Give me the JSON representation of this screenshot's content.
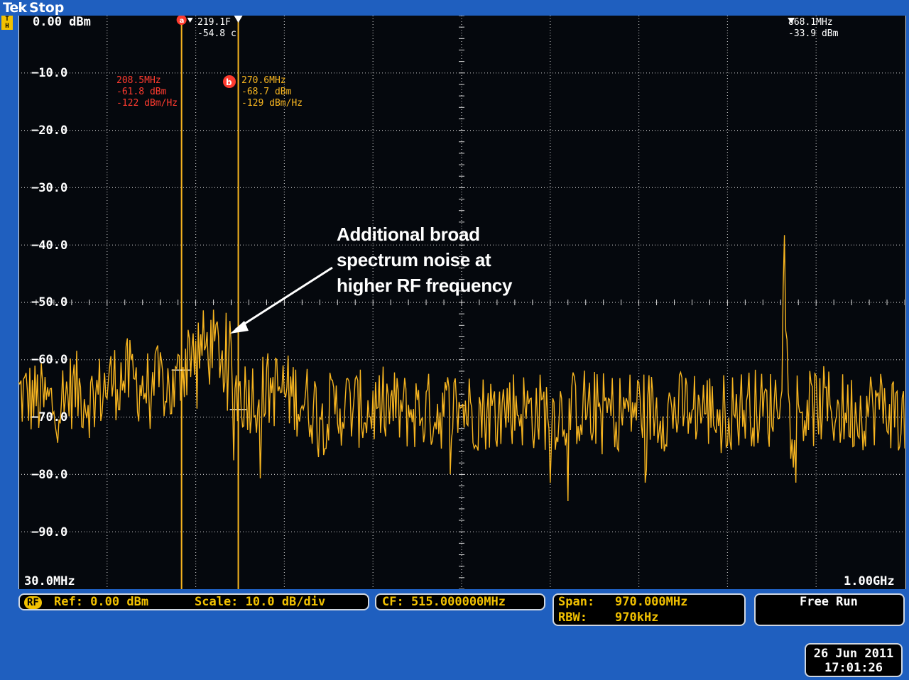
{
  "header": {
    "brand": "Tek",
    "state": "Stop",
    "trigger_badge": "T\nH"
  },
  "y_axis": {
    "top_label": "0.00 dBm",
    "ticks": [
      "−10.0",
      "−20.0",
      "−30.0",
      "−40.0",
      "−50.0",
      "−60.0",
      "−70.0",
      "−80.0",
      "−90.0"
    ]
  },
  "x_axis": {
    "start": "30.0MHz",
    "stop": "1.00GHz"
  },
  "markers": {
    "a": {
      "id": "a",
      "freq": "208.5MHz",
      "level": "-61.8 dBm",
      "density": "-122 dBm/Hz",
      "color": "#ff3b2f"
    },
    "b": {
      "id": "b",
      "freq": "270.6MHz",
      "level": "-68.7 dBm",
      "density": "-129 dBm/Hz",
      "color": "#f7b520"
    },
    "peak1": {
      "freq": "219.1F",
      "level": "-54.8 c"
    },
    "peak2": {
      "freq": "868.1MHz",
      "level": "-33.9 dBm"
    }
  },
  "annotation": {
    "line1": "Additional broad",
    "line2": "spectrum noise at",
    "line3": "higher RF frequency"
  },
  "status": {
    "rf_badge": "RF",
    "ref": "Ref: 0.00 dBm",
    "scale": "Scale: 10.0 dB/div",
    "cf": "CF: 515.000000MHz",
    "span_label": "Span:",
    "span_value": "970.000MHz",
    "rbw_label": "RBW:",
    "rbw_value": "970kHz",
    "trigger": "Free Run"
  },
  "datetime": {
    "date": "26 Jun 2011",
    "time": "17:01:26"
  },
  "colors": {
    "trace": "#f7b520",
    "grid": "#d9d9d9",
    "frame": "#1f5fbf",
    "marker_a": "#ff3b2f",
    "marker_b": "#f7b520"
  },
  "chart_data": {
    "type": "line",
    "xlim_mhz": [
      30,
      1000
    ],
    "ylim_dbm": [
      -100,
      0
    ],
    "x_mhz": [
      30,
      50,
      70,
      90,
      110,
      130,
      150,
      170,
      190,
      200,
      210,
      220,
      230,
      240,
      250,
      260,
      270,
      290,
      310,
      330,
      350,
      370,
      390,
      410,
      430,
      450,
      470,
      490,
      510,
      530,
      550,
      570,
      590,
      610,
      630,
      650,
      670,
      690,
      710,
      730,
      750,
      770,
      790,
      810,
      830,
      850,
      860,
      866,
      868,
      870,
      876,
      890,
      910,
      930,
      950,
      970,
      990,
      1000
    ],
    "y_dbm": [
      -66,
      -67,
      -68,
      -65,
      -67,
      -64,
      -63,
      -65,
      -64,
      -66,
      -61,
      -57,
      -58,
      -58,
      -58,
      -59,
      -66,
      -66,
      -65,
      -66,
      -68,
      -69,
      -68,
      -69,
      -68,
      -69,
      -69,
      -69,
      -68,
      -69,
      -69,
      -68,
      -69,
      -69,
      -69,
      -68,
      -69,
      -69,
      -68,
      -69,
      -69,
      -68,
      -69,
      -69,
      -68,
      -69,
      -67,
      -60,
      -34,
      -58,
      -67,
      -69,
      -68,
      -69,
      -69,
      -68,
      -69,
      -70
    ]
  }
}
